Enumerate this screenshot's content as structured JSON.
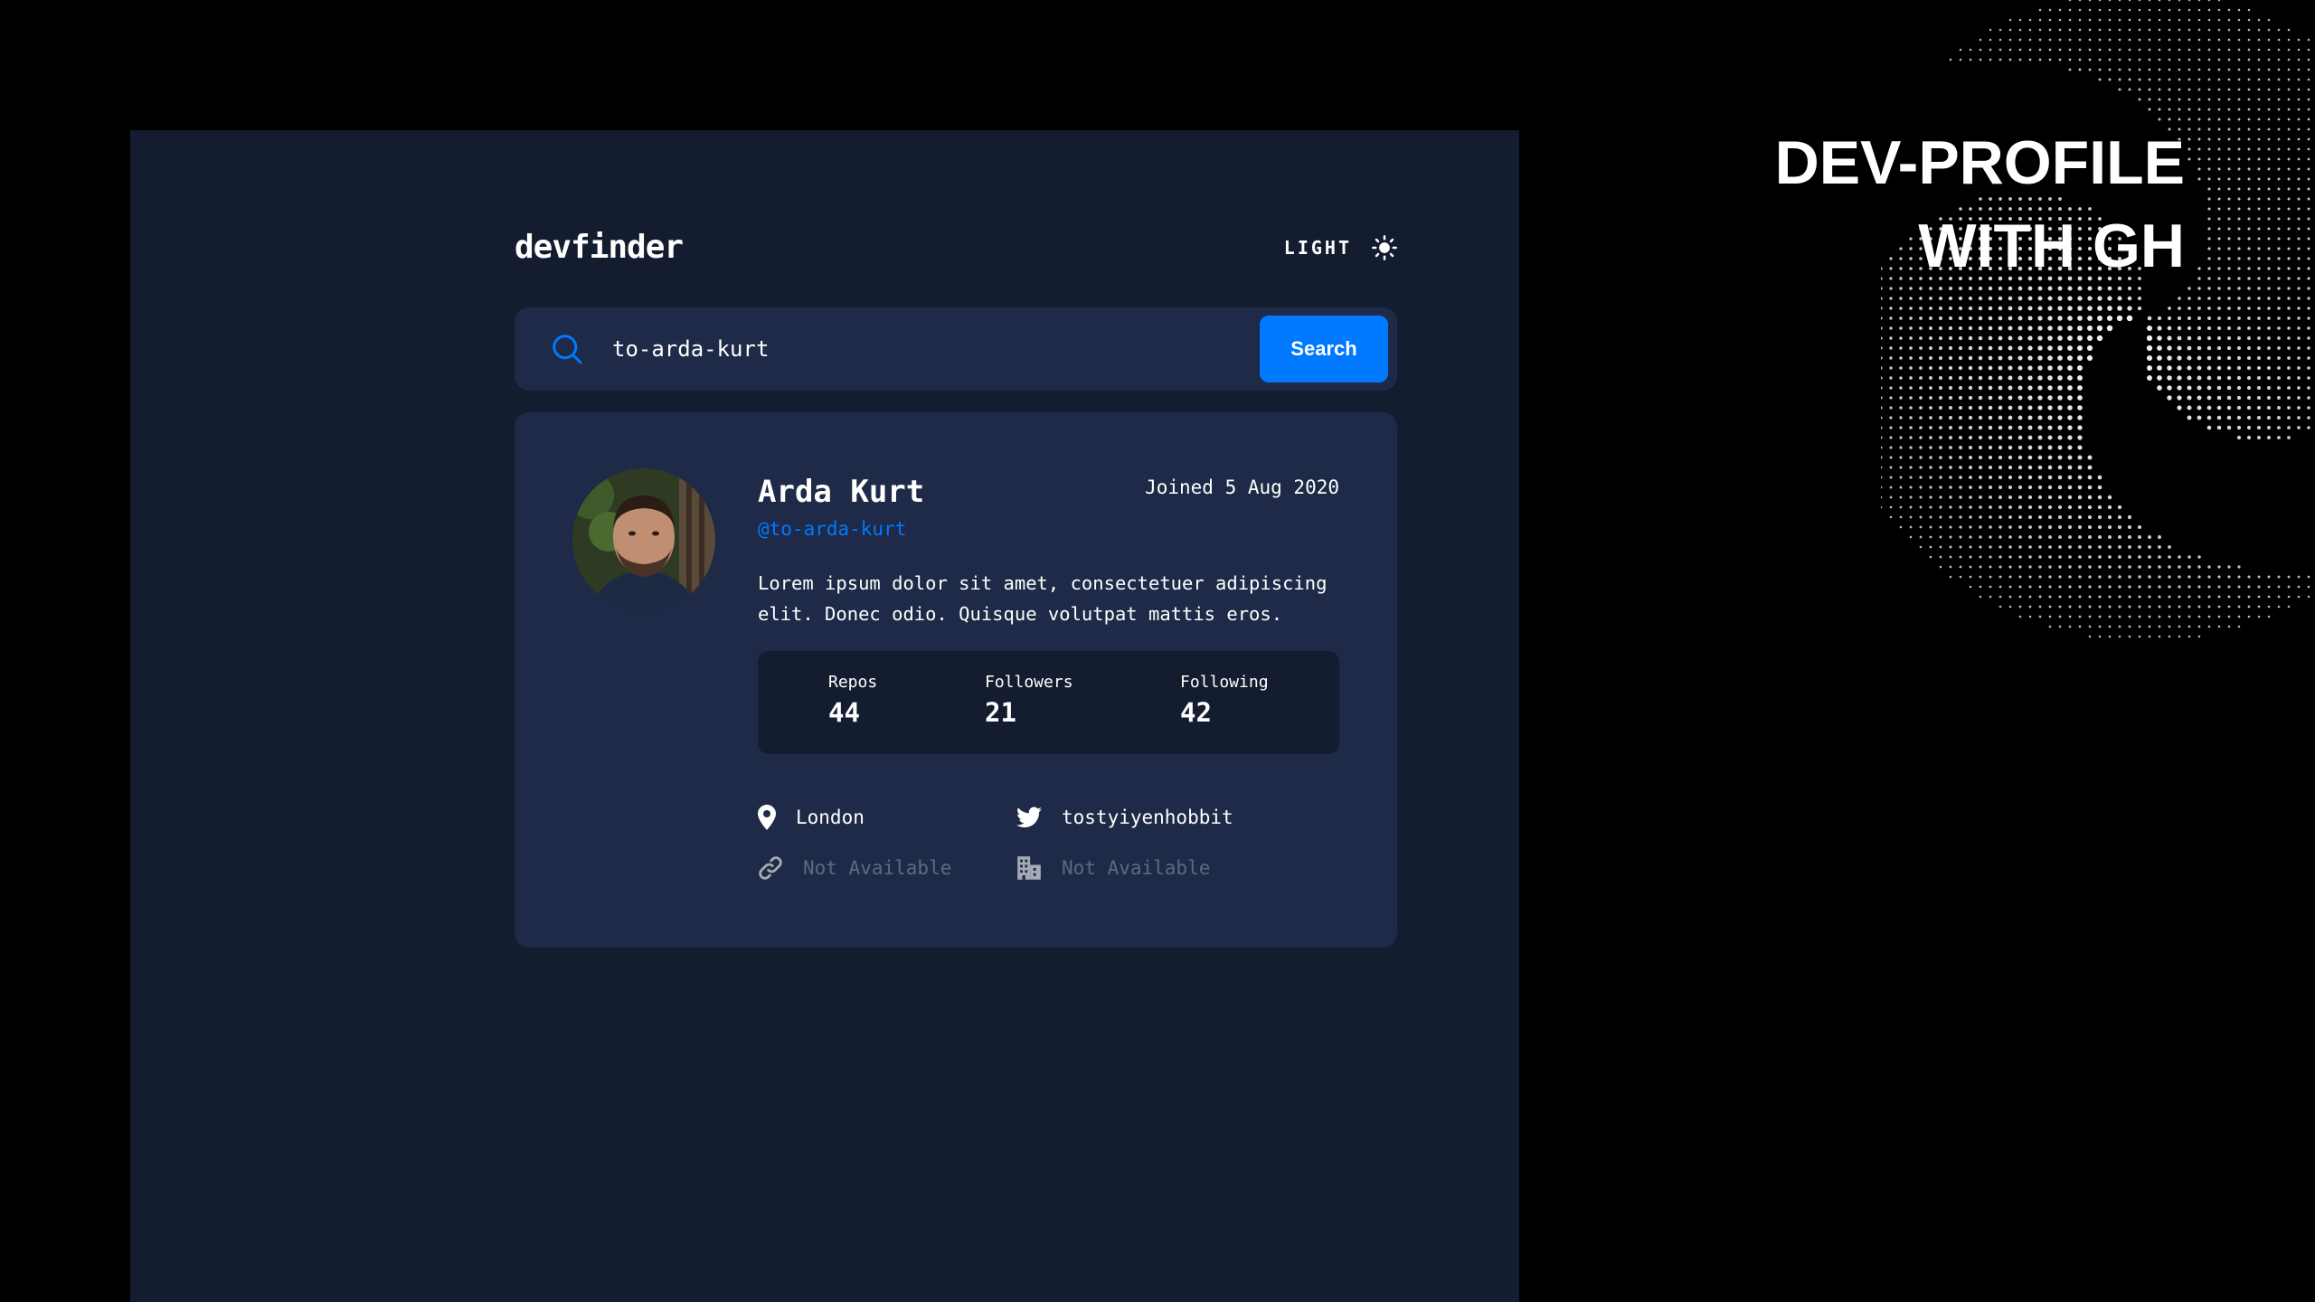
{
  "header": {
    "logo": "devfinder",
    "theme_label": "LIGHT",
    "theme_icon": "sun-icon"
  },
  "search": {
    "value": "to-arda-kurt",
    "placeholder": "",
    "button_label": "Search",
    "icon": "search-icon"
  },
  "profile": {
    "name": "Arda Kurt",
    "handle": "@to-arda-kurt",
    "joined": "Joined 5 Aug 2020",
    "bio": "Lorem ipsum dolor sit amet, consectetuer adipiscing elit. Donec odio. Quisque volutpat mattis eros.",
    "stats": [
      {
        "label": "Repos",
        "value": "44"
      },
      {
        "label": "Followers",
        "value": "21"
      },
      {
        "label": "Following",
        "value": "42"
      }
    ],
    "links": {
      "location": "London",
      "twitter": "tostyiyenhobbit",
      "blog": "Not Available",
      "company": "Not Available"
    }
  },
  "promo": {
    "line1": "DEV-PROFILE",
    "line2": "WITH GH"
  },
  "colors": {
    "page_bg": "#000000",
    "panel_bg": "#141d2f",
    "card_bg": "#1e2a47",
    "accent": "#0079ff",
    "text": "#ffffff",
    "muted": "#8a93a8"
  }
}
